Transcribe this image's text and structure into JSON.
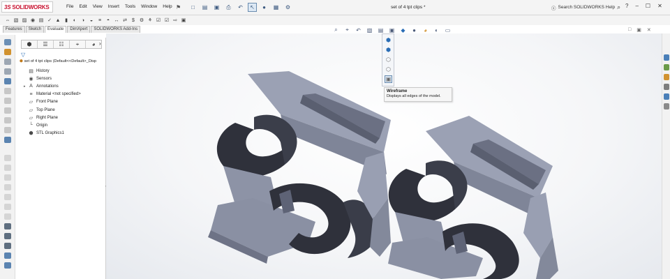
{
  "app": {
    "logo_ds": "3S",
    "logo_name": "SOLIDWORKS",
    "document_title": "set of 4 tpt clips *",
    "help_search": "Search SOLIDWORKS Help"
  },
  "menu": [
    "File",
    "Edit",
    "View",
    "Insert",
    "Tools",
    "Window",
    "Help"
  ],
  "tabs": [
    {
      "label": "Features",
      "active": false
    },
    {
      "label": "Sketch",
      "active": false
    },
    {
      "label": "Evaluate",
      "active": true
    },
    {
      "label": "DimXpert",
      "active": false
    },
    {
      "label": "SOLIDWORKS Add-Ins",
      "active": false
    }
  ],
  "feature_tree": {
    "root": "set of 4 tpt clips  (Default<<Default>_Disp",
    "items": [
      {
        "label": "History",
        "icon": "history-folder-icon",
        "expand": false
      },
      {
        "label": "Sensors",
        "icon": "sensors-icon",
        "expand": false
      },
      {
        "label": "Annotations",
        "icon": "annotations-icon",
        "expand": true
      },
      {
        "label": "Material <not specified>",
        "icon": "material-icon",
        "expand": false
      },
      {
        "label": "Front Plane",
        "icon": "plane-icon",
        "expand": false
      },
      {
        "label": "Top Plane",
        "icon": "plane-icon",
        "expand": false
      },
      {
        "label": "Right Plane",
        "icon": "plane-icon",
        "expand": false
      },
      {
        "label": "Origin",
        "icon": "origin-icon",
        "expand": false
      },
      {
        "label": "STL Graphics1",
        "icon": "stl-graphics-icon",
        "expand": false
      }
    ]
  },
  "tooltip": {
    "title": "Wireframe",
    "description": "Displays all edges of the model."
  },
  "colors": {
    "model_face": "#8d93a6",
    "model_shadow": "#2f313b",
    "accent": "#c8102e"
  }
}
